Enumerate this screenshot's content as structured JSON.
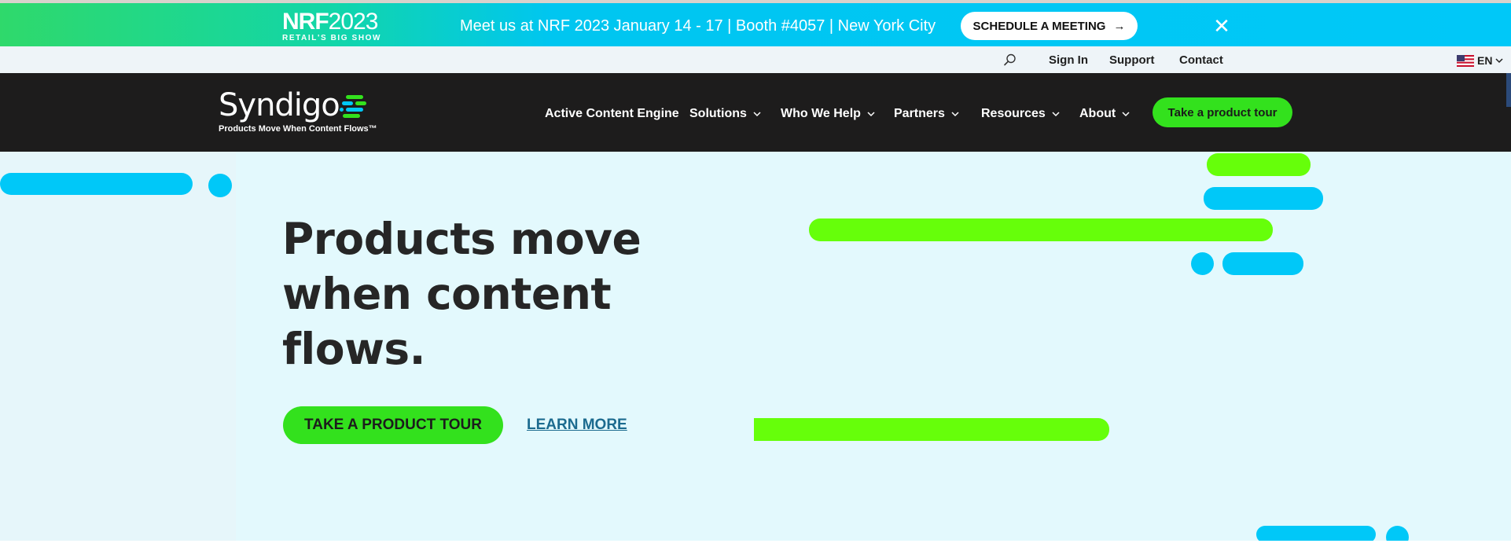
{
  "promo": {
    "logo_bold": "NRF",
    "logo_year": "2023",
    "logo_sub": "RETAIL'S BIG SHOW",
    "message": "Meet us at NRF 2023 January 14 - 17 | Booth #4057 | New York City",
    "cta_label": "SCHEDULE A MEETING",
    "cta_arrow": "→",
    "close_glyph": "✕"
  },
  "utility": {
    "links": [
      "Sign In",
      "Support",
      "Contact"
    ],
    "language": "EN"
  },
  "nav": {
    "logo_word": "Syndigo",
    "logo_tagline": "Products Move When Content Flows™",
    "items": [
      "Active Content Engine",
      "Solutions",
      "Who We Help",
      "Partners",
      "Resources",
      "About"
    ],
    "cta_label": "Take a product tour"
  },
  "hero": {
    "headline": "Products move when content flows.",
    "primary_cta": "TAKE A PRODUCT TOUR",
    "secondary_cta": "LEARN MORE"
  },
  "colors": {
    "brand_green": "#33e11d",
    "accent_cyan": "#00c8f8",
    "accent_lime": "#66ff0a",
    "nav_bg": "#1d1c1c",
    "hero_bg": "#e3f9fd"
  }
}
